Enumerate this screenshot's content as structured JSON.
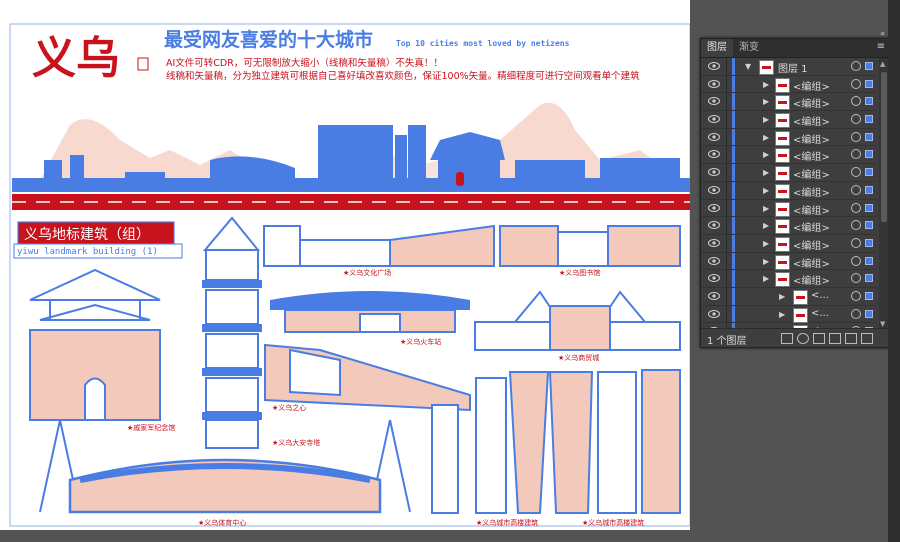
{
  "artboard": {
    "city_title": "义乌",
    "heading_cn": "最受网友喜爱的十大城市",
    "heading_en": "Top 10 cities most loved by netizens",
    "note_line1": "AI文件可转CDR，可无限制放大缩小（线稿和矢量稿）不失真！！",
    "note_line2": "线稿和矢量稿，分为独立建筑可根据自己喜好填改喜欢颜色，保证100%矢量。精细程度可进行空间观看单个建筑",
    "section_title_cn": "义乌地标建筑（组）",
    "section_title_en": "yiwu landmark building (1)",
    "captions": {
      "culture_square": "★义乌文化广场",
      "library": "★义乌图书馆",
      "railway_station": "★义乌火车站",
      "trade_city": "★义乌商贸城",
      "heart_of_yiwu": "★义乌之心",
      "memorial_hall": "★戚家军纪念馆",
      "daan_temple_tower": "★义乌大安寺塔",
      "stadium": "★义乌体育中心",
      "highrise_1": "★义乌城市高楼建筑",
      "highrise_2": "★义乌城市高楼建筑"
    },
    "colors": {
      "blue": "#4a7de4",
      "red": "#c8121c",
      "pink": "#f3c9bb"
    }
  },
  "layers_panel": {
    "tabs": [
      "图层",
      "渐变"
    ],
    "active_tab": "图层",
    "top_layer": "图层 1",
    "group_label": "<编组>",
    "sub_label": "<...",
    "group_count": 12,
    "sub_count": 3,
    "footer_count": "1 个图层",
    "colors": {
      "selection_blue": "#4a7de4"
    }
  }
}
